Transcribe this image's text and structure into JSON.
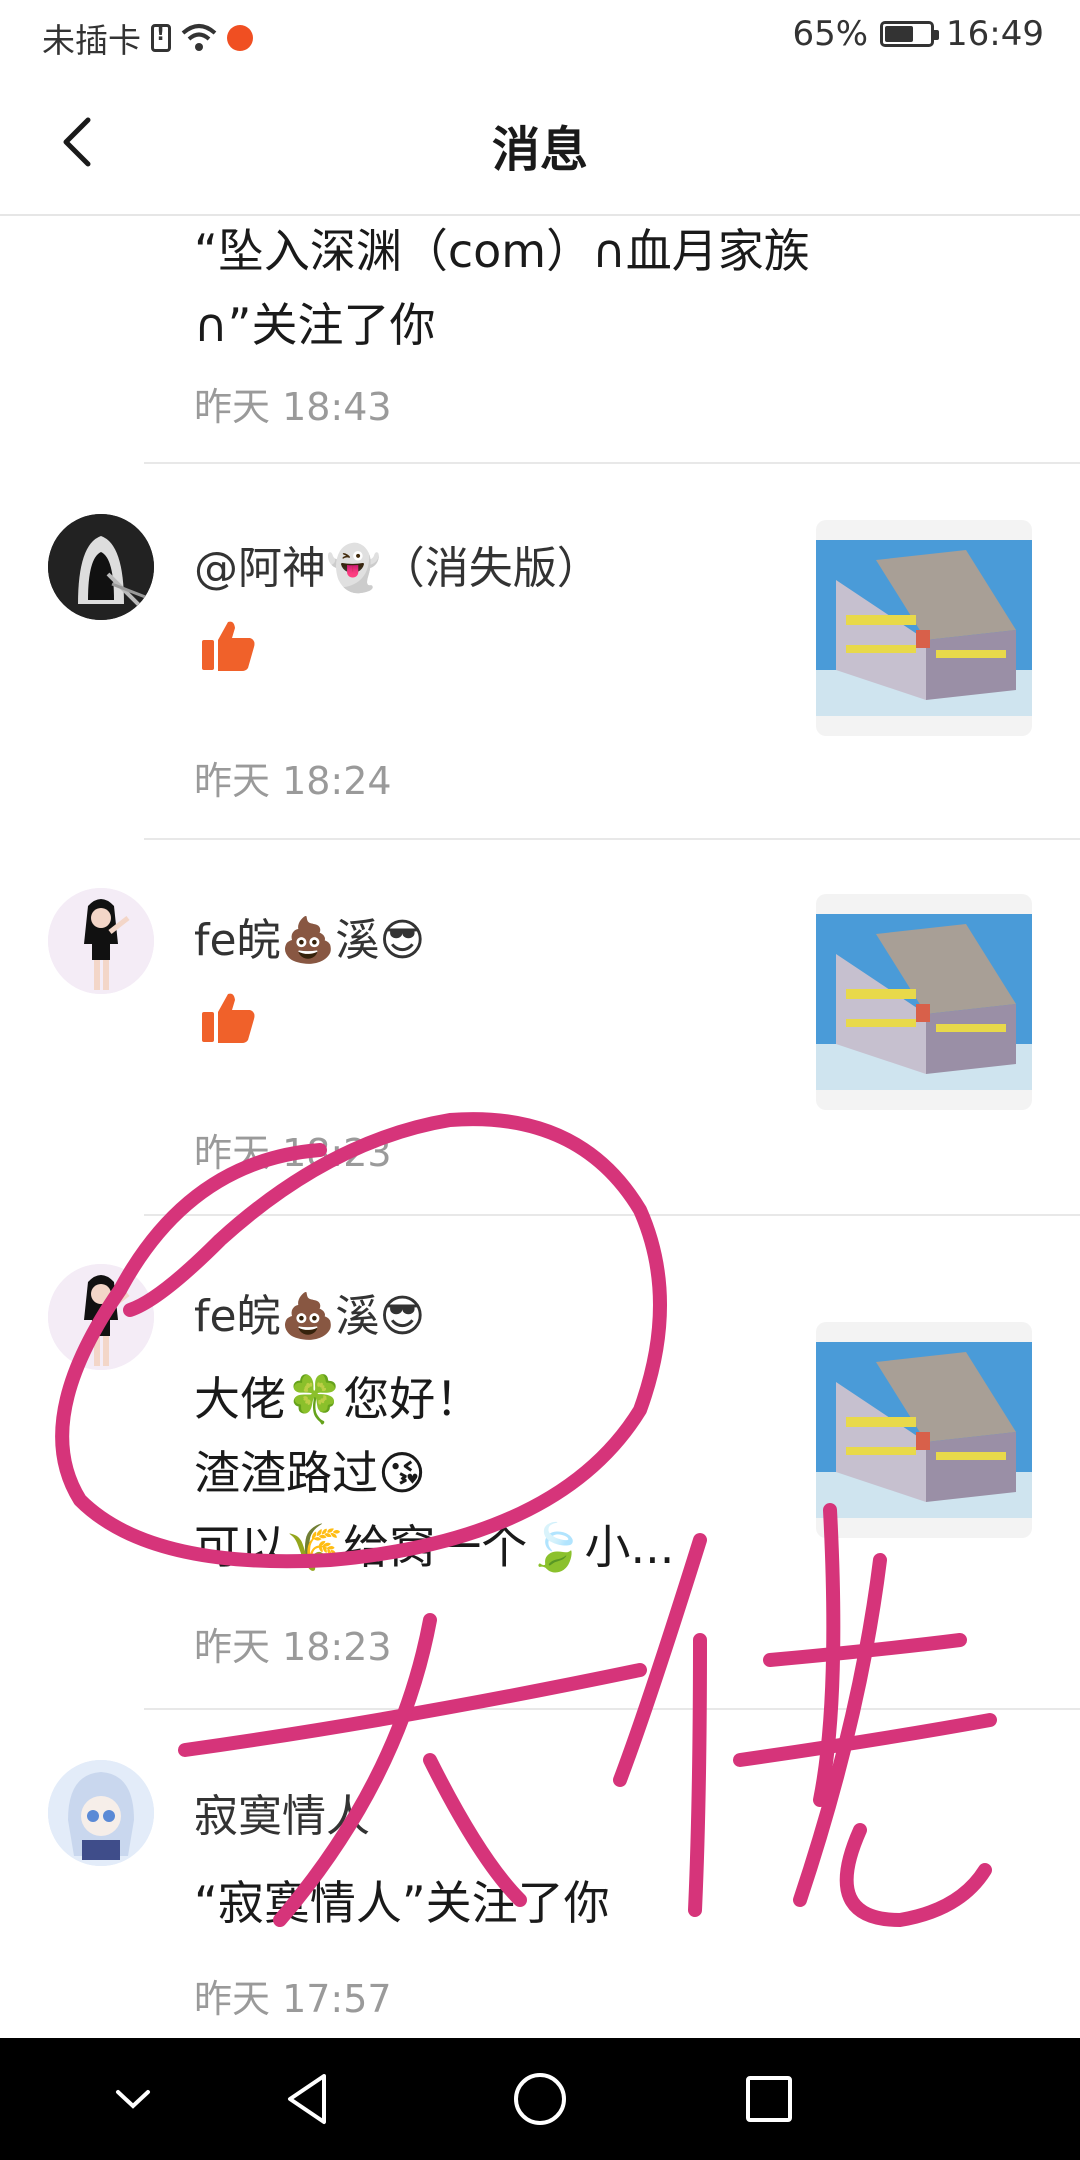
{
  "status_bar": {
    "carrier": "未插卡",
    "battery_percent": "65%",
    "time": "16:49"
  },
  "header": {
    "title": "消息"
  },
  "messages": [
    {
      "content_line1": "“坠入深渊（com）∩血月家族",
      "content_line2": "∩”关注了你",
      "time": "昨天 18:43"
    },
    {
      "name": "@阿神👻（消失版）",
      "type": "like",
      "time": "昨天 18:24"
    },
    {
      "name": "fe皖💩溪😎",
      "type": "like",
      "time": "昨天 18:23"
    },
    {
      "name": "fe皖💩溪😎",
      "type": "comment",
      "content_line1": "大佬🍀您好！",
      "content_line2": "渣渣路过😘",
      "content_line3": "可以🌾给窝一个🍃小...",
      "time": "昨天 18:23"
    },
    {
      "name": "寂寞情人",
      "content_line1": "“寂寞情人”关注了你",
      "time": "昨天 17:57"
    }
  ],
  "colors": {
    "like": "#f0612a",
    "scribble": "#d6347a",
    "time_text": "#9a9a9a"
  }
}
